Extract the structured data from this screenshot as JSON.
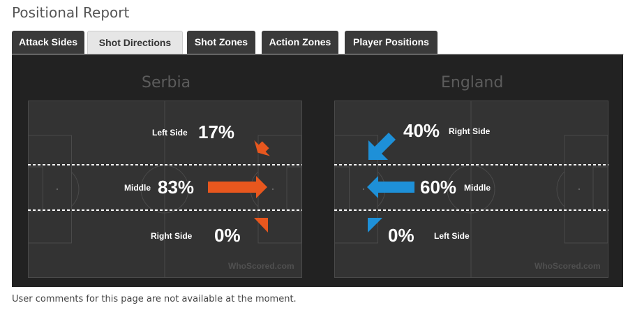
{
  "page_title": "Positional Report",
  "tabs": [
    {
      "label": "Attack Sides",
      "active": false
    },
    {
      "label": "Shot Directions",
      "active": true
    },
    {
      "label": "Shot Zones",
      "active": false
    },
    {
      "label": "Action Zones",
      "active": false
    },
    {
      "label": "Player Positions",
      "active": false
    }
  ],
  "teams": {
    "left": {
      "name": "Serbia",
      "color": "#e8571e",
      "left_side": {
        "label": "Left Side",
        "value": "17%"
      },
      "middle": {
        "label": "Middle",
        "value": "83%"
      },
      "right_side": {
        "label": "Right Side",
        "value": "0%"
      }
    },
    "right": {
      "name": "England",
      "color": "#1e90d8",
      "right_side": {
        "label": "Right Side",
        "value": "40%"
      },
      "middle": {
        "label": "Middle",
        "value": "60%"
      },
      "left_side": {
        "label": "Left Side",
        "value": "0%"
      }
    }
  },
  "watermark": "WhoScored.com",
  "footer_text": "User comments for this page are not available at the moment."
}
